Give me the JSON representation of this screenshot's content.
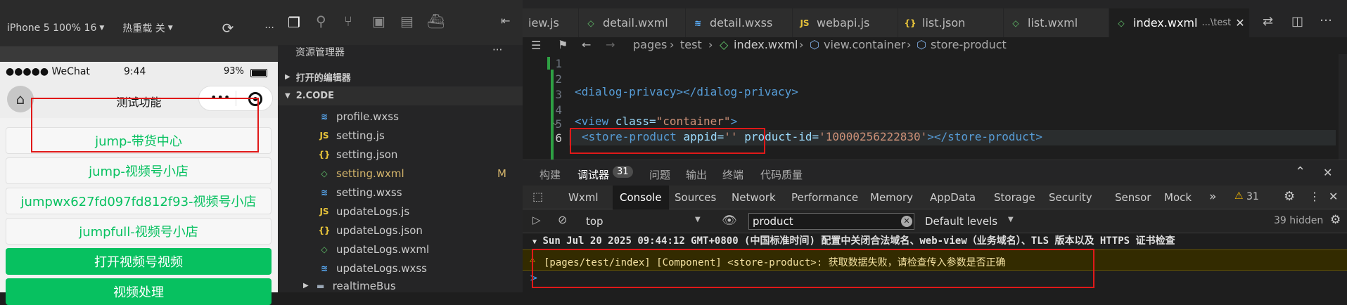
{
  "simulator": {
    "toolbar": {
      "device": "iPhone 5 100% 16",
      "hotreload": "热重载 关",
      "more": "···"
    },
    "status": {
      "signal": "●●●●● WeChat",
      "time": "9:44",
      "battery": "93%"
    },
    "nav_title": "测试功能",
    "buttons": [
      {
        "label": "jump-带货中心",
        "style": "white"
      },
      {
        "label": "jump-视频号小店",
        "style": "white"
      },
      {
        "label": "jumpwx627fd097fd812f93-视频号小店",
        "style": "white"
      },
      {
        "label": "jumpfull-视频号小店",
        "style": "white"
      },
      {
        "label": "打开视频号视频",
        "style": "green"
      },
      {
        "label": "视频处理",
        "style": "green"
      }
    ]
  },
  "explorer": {
    "title": "资源管理器",
    "more": "···",
    "open_editors": "打开的编辑器",
    "root": "2.CODE",
    "files": [
      {
        "name": "profile.wxss",
        "icon": "wxss",
        "status": ""
      },
      {
        "name": "setting.js",
        "icon": "js",
        "status": ""
      },
      {
        "name": "setting.json",
        "icon": "json",
        "status": ""
      },
      {
        "name": "setting.wxml",
        "icon": "wxml",
        "status": "M"
      },
      {
        "name": "setting.wxss",
        "icon": "wxss",
        "status": ""
      },
      {
        "name": "updateLogs.js",
        "icon": "js",
        "status": ""
      },
      {
        "name": "updateLogs.json",
        "icon": "json",
        "status": ""
      },
      {
        "name": "updateLogs.wxml",
        "icon": "wxml",
        "status": ""
      },
      {
        "name": "updateLogs.wxss",
        "icon": "wxss",
        "status": ""
      },
      {
        "name": "realtimeBus",
        "icon": "folder",
        "status": ""
      }
    ]
  },
  "editor": {
    "tabs": [
      {
        "label": "iew.js",
        "icon": "js"
      },
      {
        "label": "detail.wxml",
        "icon": "wxml"
      },
      {
        "label": "detail.wxss",
        "icon": "wxss"
      },
      {
        "label": "webapi.js",
        "icon": "js"
      },
      {
        "label": "list.json",
        "icon": "json"
      },
      {
        "label": "list.wxml",
        "icon": "wxml"
      },
      {
        "label": "index.wxml",
        "icon": "wxml",
        "suffix": "...\\test"
      }
    ],
    "breadcrumb": [
      "pages",
      "test",
      "index.wxml",
      "view.container",
      "store-product"
    ],
    "line_numbers": [
      "1",
      "2",
      "3",
      "4",
      "5",
      "6"
    ],
    "code": {
      "l3_open": "<dialog-privacy>",
      "l3_close": "</dialog-privacy>",
      "l5_open": "<view ",
      "l5_attr": "class=",
      "l5_val": "\"container\"",
      "l5_end": ">",
      "l6_open": "<store-product ",
      "l6_attr1": "appid=",
      "l6_val1": "''",
      "l6_attr2": " product-id=",
      "l6_val2": "'10000256222830'",
      "l6_end": "></store-product>"
    }
  },
  "panel": {
    "tabs": [
      "构建",
      "调试器",
      "问题",
      "输出",
      "终端",
      "代码质量"
    ],
    "debugger_count": "31",
    "devtools_tabs": [
      "Wxml",
      "Console",
      "Sources",
      "Network",
      "Performance",
      "Memory",
      "AppData",
      "Storage",
      "Security",
      "Sensor",
      "Mock"
    ],
    "warn_count": "31",
    "context": "top",
    "filter_value": "product",
    "levels": "Default levels",
    "hidden": "39 hidden",
    "log_line": "Sun Jul 20 2025 09:44:12 GMT+0800 (中国标准时间) 配置中关闭合法域名、web-view（业务域名）、TLS 版本以及 HTTPS 证书检查",
    "warning": "[pages/test/index] [Component] <store-product>: 获取数据失败，请检查传入参数是否正确",
    "prompt": ">"
  },
  "colors": {
    "accent_green": "#07c160",
    "highlight_red": "#e01919",
    "warning_bg": "#332b00"
  }
}
